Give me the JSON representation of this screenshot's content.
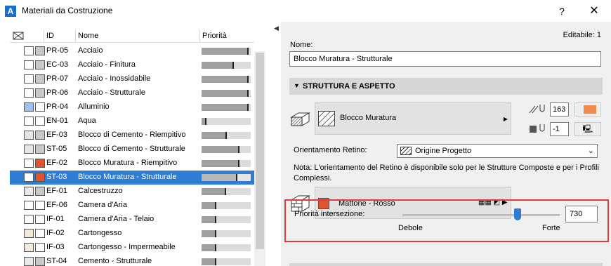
{
  "window": {
    "title": "Materiali da Costruzione",
    "help": "?",
    "close": "✕"
  },
  "list": {
    "headers": {
      "id": "ID",
      "name": "Nome",
      "priority": "Priorità"
    },
    "rows": [
      {
        "id": "PR-05",
        "name": "Acciaio",
        "priority": 0.95,
        "sw1": "#ffffff",
        "sw2": "#c8c8c8"
      },
      {
        "id": "EC-03",
        "name": "Acciaio - Finitura",
        "priority": 0.65,
        "sw1": "#ffffff",
        "sw2": "#c8c8c8"
      },
      {
        "id": "PR-07",
        "name": "Acciaio - Inossidabile",
        "priority": 0.95,
        "sw1": "#ffffff",
        "sw2": "#c8c8c8"
      },
      {
        "id": "PR-06",
        "name": "Acciaio - Strutturale",
        "priority": 0.95,
        "sw1": "#ffffff",
        "sw2": "#c8c8c8"
      },
      {
        "id": "PR-04",
        "name": "Alluminio",
        "priority": 0.95,
        "sw1": "#9cc3ee",
        "sw2": "#ffffff"
      },
      {
        "id": "EN-01",
        "name": "Aqua",
        "priority": 0.1,
        "sw1": "#ffffff",
        "sw2": "#ffffff"
      },
      {
        "id": "EF-03",
        "name": "Blocco di Cemento - Riempitivo",
        "priority": 0.52,
        "sw1": "#e6e6e6",
        "sw2": "#c8c8c8"
      },
      {
        "id": "ST-05",
        "name": "Blocco di Cemento - Strutturale",
        "priority": 0.77,
        "sw1": "#e6e6e6",
        "sw2": "#c8c8c8"
      },
      {
        "id": "EF-02",
        "name": "Blocco Muratura - Riempitivo",
        "priority": 0.77,
        "sw1": "#ffffff",
        "sw2": "#e0552e"
      },
      {
        "id": "ST-03",
        "name": "Blocco Muratura - Strutturale",
        "priority": 0.73,
        "sw1": "#ffffff",
        "sw2": "#e0552e",
        "selected": true
      },
      {
        "id": "EF-01",
        "name": "Calcestruzzo",
        "priority": 0.5,
        "sw1": "#e8e8e8",
        "sw2": "#c8c8c8"
      },
      {
        "id": "EF-06",
        "name": "Camera d'Aria",
        "priority": 0.3,
        "sw1": "#ffffff",
        "sw2": "#ffffff"
      },
      {
        "id": "IF-01",
        "name": "Camera d'Aria - Telaio",
        "priority": 0.3,
        "sw1": "#ffffff",
        "sw2": "#ffffff"
      },
      {
        "id": "IF-02",
        "name": "Cartongesso",
        "priority": 0.3,
        "sw1": "#f0ead8",
        "sw2": "#ffffff"
      },
      {
        "id": "IF-03",
        "name": "Cartongesso - Impermeabile",
        "priority": 0.3,
        "sw1": "#f0ead8",
        "sw2": "#ffffff"
      },
      {
        "id": "ST-04",
        "name": "Cemento - Strutturale",
        "priority": 0.3,
        "sw1": "#e8e8e8",
        "sw2": "#c8c8c8"
      }
    ]
  },
  "editor": {
    "editable": "Editabile: 1",
    "name_label": "Nome:",
    "name_value": "Blocco Muratura - Strutturale",
    "section_title": "STRUTTURA E ASPETTO",
    "structure_label": "Blocco Muratura",
    "pen_value": "163",
    "bg_pen_value": "-1",
    "orient_label": "Orientamento Retino:",
    "orient_value": "Origine Progetto",
    "note": "Nota: L'orientamento del Retino è disponibile solo per le Strutture Composte e per i Profili Complessi.",
    "surface_label": "Mattone - Rosso",
    "priority_label": "Priorità intersezione:",
    "priority_min": "Debole",
    "priority_max": "Forte",
    "priority_value": "730",
    "priority_level": 0.73,
    "accent": "#2f7cd5",
    "highlight": "#e03c3c"
  }
}
